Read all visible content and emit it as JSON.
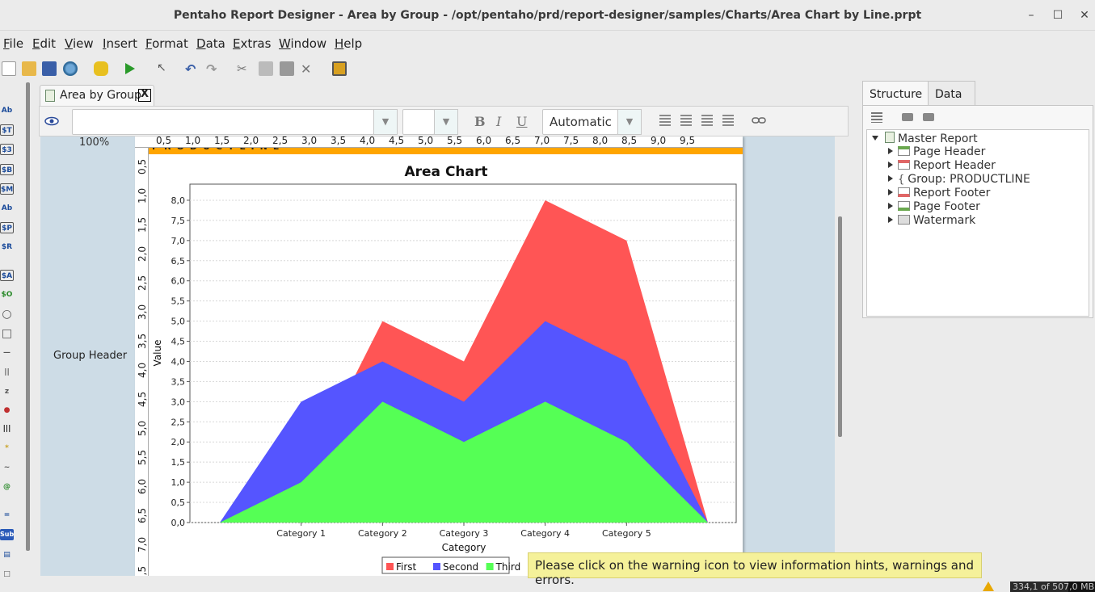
{
  "window": {
    "title": "Pentaho Report Designer - Area by Group - /opt/pentaho/prd/report-designer/samples/Charts/Area Chart by Line.prpt",
    "minimize": "–",
    "maximize": "☐",
    "close": "✕"
  },
  "menu": [
    "File",
    "Edit",
    "View",
    "Insert",
    "Format",
    "Data",
    "Extras",
    "Window",
    "Help"
  ],
  "toolbar_icons": [
    "new-icon",
    "open-icon",
    "save-icon",
    "preview-icon",
    "datasource-icon",
    "run-icon",
    "select-icon",
    "undo-icon",
    "redo-icon",
    "cut-icon",
    "copy-icon",
    "paste-icon",
    "delete-icon",
    "publish-icon"
  ],
  "palette": [
    "Ab",
    "$T",
    "$3",
    "$B",
    "$M",
    "Ab",
    "$P",
    "$R",
    "$A",
    "$O",
    "○",
    "□",
    "—",
    "||",
    "z",
    "●",
    "|||",
    "*",
    "~",
    "@",
    "=",
    "Sub",
    "▤",
    "□"
  ],
  "document_tab": {
    "label": "Area by Group",
    "close": "X"
  },
  "format_bar": {
    "font_value": "",
    "size_value": "",
    "bold": "B",
    "italic": "I",
    "underline": "U",
    "color_value": "Automatic"
  },
  "canvas": {
    "zoom": "100%",
    "band_label": "Group Header",
    "header_text": "PRODUCTLINE",
    "hruler": [
      "0,5",
      "1,0",
      "1,5",
      "2,0",
      "2,5",
      "3,0",
      "3,5",
      "4,0",
      "4,5",
      "5,0",
      "5,5",
      "6,0",
      "6,5",
      "7,0",
      "7,5",
      "8,0",
      "8,5",
      "9,0",
      "9,5"
    ],
    "vruler": [
      "0,5",
      "1,0",
      "1,5",
      "2,0",
      "2,5",
      "3,0",
      "3,5",
      "4,0",
      "4,5",
      "5,0",
      "5,5",
      "6,0",
      "6,5",
      "7,0",
      "7,5"
    ]
  },
  "chart_data": {
    "type": "area",
    "title": "Area Chart",
    "xlabel": "Category",
    "ylabel": "Value",
    "categories": [
      "Category 1",
      "Category 2",
      "Category 3",
      "Category 4",
      "Category 5"
    ],
    "ylim": [
      0,
      8.4
    ],
    "yticks": [
      "0,0",
      "0,5",
      "1,0",
      "1,5",
      "2,0",
      "2,5",
      "3,0",
      "3,5",
      "4,0",
      "4,5",
      "5,0",
      "5,5",
      "6,0",
      "6,5",
      "7,0",
      "7,5",
      "8,0"
    ],
    "grid": true,
    "legend": "bottom",
    "series": [
      {
        "name": "First",
        "color": "#ff5555",
        "values": [
          0.0,
          1.0,
          5.0,
          4.0,
          8.0,
          7.0,
          0.0
        ]
      },
      {
        "name": "Second",
        "color": "#5555ff",
        "values": [
          0.0,
          3.0,
          4.0,
          3.0,
          5.0,
          4.0,
          0.0
        ]
      },
      {
        "name": "Third",
        "color": "#55ff55",
        "values": [
          0.0,
          1.0,
          3.0,
          2.0,
          3.0,
          2.0,
          0.0
        ]
      }
    ]
  },
  "side_panel": {
    "tabs": [
      "Structure",
      "Data"
    ],
    "tree": [
      "Master Report",
      "Page Header",
      "Report Header",
      "Group: PRODUCTLINE",
      "Report Footer",
      "Page Footer",
      "Watermark"
    ]
  },
  "status": {
    "hint": "Please click on the warning icon to view information hints, warnings and errors.",
    "memory": "334,1 of 507,0 MB"
  }
}
